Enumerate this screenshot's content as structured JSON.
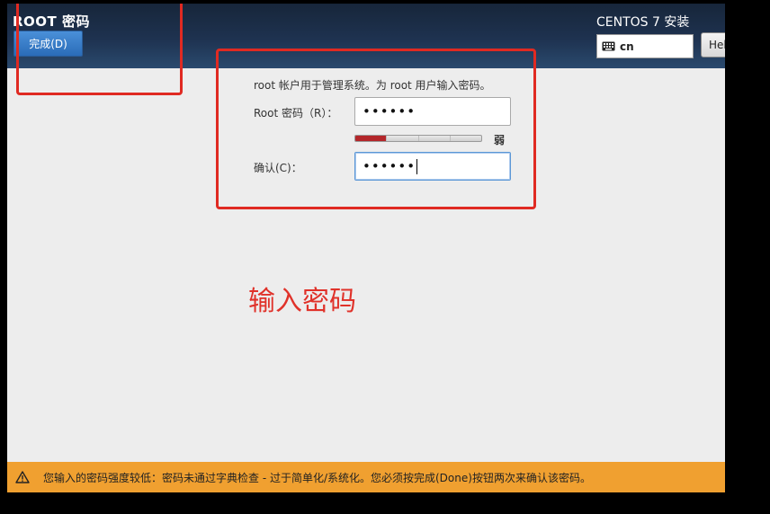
{
  "header": {
    "title": "ROOT 密码",
    "done_label": "完成(D)",
    "product": "CENTOS 7 安装",
    "keyboard_layout": "cn",
    "help_label": "Help!"
  },
  "form": {
    "intro": "root 帐户用于管理系统。为 root 用户输入密码。",
    "root_password_label": "Root 密码（R）：",
    "root_password_value": "••••••",
    "strength_label": "弱",
    "strength_fraction": 0.25,
    "confirm_label": "确认(C)：",
    "confirm_value": "••••••"
  },
  "annotation": {
    "text": "输入密码",
    "color": "#e02a22"
  },
  "warning": {
    "text": "您输入的密码强度较低：密码未通过字典检查 - 过于简单化/系统化。您必须按完成(Done)按钮两次来确认该密码。",
    "color": "#f0a030",
    "icon": "warning-icon"
  }
}
